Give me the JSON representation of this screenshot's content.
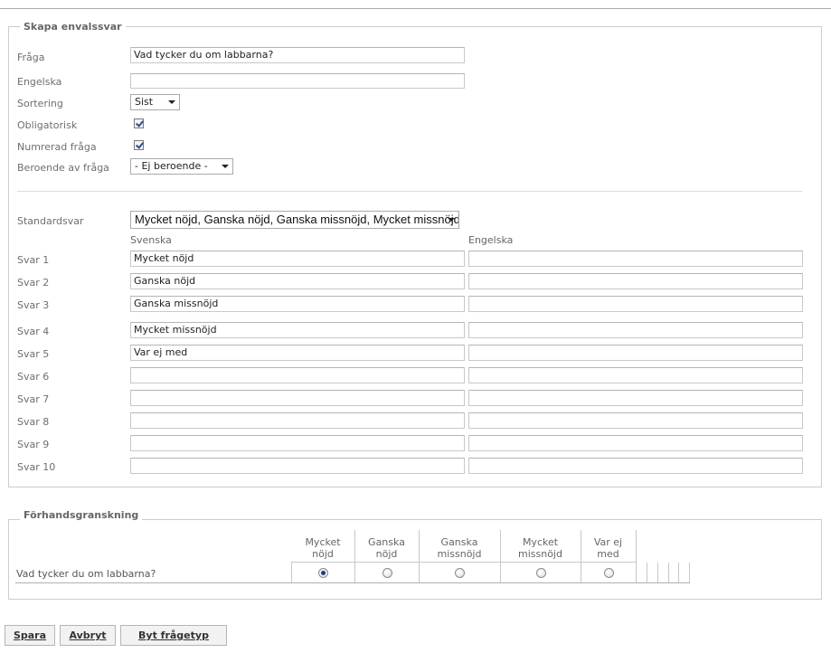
{
  "form": {
    "legend": "Skapa envalssvar",
    "fraga": {
      "label": "Fråga",
      "value": "Vad tycker du om labbarna?"
    },
    "engelska": {
      "label": "Engelska",
      "value": ""
    },
    "sortering": {
      "label": "Sortering",
      "value": "Sist"
    },
    "obligatorisk": {
      "label": "Obligatorisk",
      "checked": true
    },
    "numrerad": {
      "label": "Numrerad fråga",
      "checked": true
    },
    "beroende": {
      "label": "Beroende av fråga",
      "value": "- Ej beroende -"
    },
    "standardsvar": {
      "label": "Standardsvar",
      "value": "Mycket nöjd, Ganska nöjd, Ganska missnöjd, Mycket missnöjd, Var ej med"
    },
    "col_svenska": "Svenska",
    "col_engelska": "Engelska",
    "answers": [
      {
        "label": "Svar 1",
        "sv": "Mycket nöjd",
        "en": ""
      },
      {
        "label": "Svar 2",
        "sv": "Ganska nöjd",
        "en": ""
      },
      {
        "label": "Svar 3",
        "sv": "Ganska missnöjd",
        "en": ""
      },
      {
        "label": "Svar 4",
        "sv": "Mycket missnöjd",
        "en": ""
      },
      {
        "label": "Svar 5",
        "sv": "Var ej med",
        "en": ""
      },
      {
        "label": "Svar 6",
        "sv": "",
        "en": ""
      },
      {
        "label": "Svar 7",
        "sv": "",
        "en": ""
      },
      {
        "label": "Svar 8",
        "sv": "",
        "en": ""
      },
      {
        "label": "Svar 9",
        "sv": "",
        "en": ""
      },
      {
        "label": "Svar 10",
        "sv": "",
        "en": ""
      }
    ]
  },
  "preview": {
    "legend": "Förhandsgranskning",
    "question": "Vad tycker du om labbarna?",
    "options": [
      {
        "line1": "Mycket",
        "line2": "nöjd",
        "selected": true
      },
      {
        "line1": "Ganska",
        "line2": "nöjd",
        "selected": false
      },
      {
        "line1": "Ganska",
        "line2": "missnöjd",
        "selected": false
      },
      {
        "line1": "Mycket",
        "line2": "missnöjd",
        "selected": false
      },
      {
        "line1": "Var ej",
        "line2": "med",
        "selected": false
      }
    ]
  },
  "buttons": {
    "spara": "Spara",
    "avbryt": "Avbryt",
    "byt": "Byt frågetyp"
  }
}
